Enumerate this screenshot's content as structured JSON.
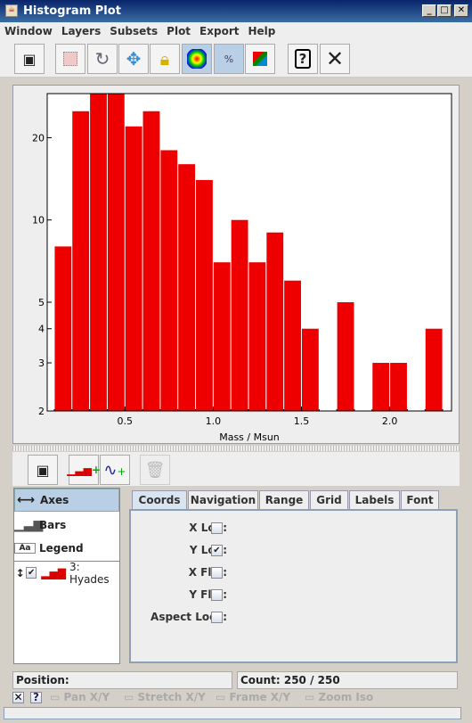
{
  "window": {
    "title": "Histogram Plot"
  },
  "menu": [
    "Window",
    "Layers",
    "Subsets",
    "Plot",
    "Export",
    "Help"
  ],
  "toolbar": [
    {
      "icon": "window-icon"
    },
    {
      "icon": "subset-draw-icon"
    },
    {
      "icon": "rescale-icon"
    },
    {
      "icon": "navigation-icon"
    },
    {
      "icon": "axis-lock-icon"
    },
    {
      "icon": "density-icon",
      "active": true
    },
    {
      "icon": "normalise-icon",
      "active": true
    },
    {
      "icon": "export-image-icon"
    },
    {
      "icon": "help-icon"
    },
    {
      "icon": "close-icon"
    }
  ],
  "chart_data": {
    "type": "bar",
    "xlabel": "Mass / Msun",
    "ylabel": "",
    "xlim": [
      0.06,
      2.35
    ],
    "ylim": [
      2,
      29
    ],
    "ylog": true,
    "bar_color": "#ee0000",
    "x_ticks": [
      "0.5",
      "1.0",
      "1.5",
      "2.0"
    ],
    "y_ticks": [
      "2",
      "3",
      "4",
      "5",
      "10",
      "20"
    ],
    "bin_width": 0.1,
    "bin_starts": [
      0.1,
      0.2,
      0.3,
      0.4,
      0.5,
      0.6,
      0.7,
      0.8,
      0.9,
      1.0,
      1.1,
      1.2,
      1.3,
      1.4,
      1.5,
      1.6,
      1.7,
      1.8,
      1.9,
      2.0,
      2.1,
      2.2
    ],
    "values": [
      8,
      25,
      29,
      29,
      22,
      25,
      18,
      16,
      14,
      7,
      10,
      7,
      9,
      6,
      4,
      1,
      5,
      1,
      3,
      3,
      1,
      4
    ]
  },
  "control": {
    "layers": [
      {
        "label": "Axes",
        "selected": true
      },
      {
        "label": "Bars"
      },
      {
        "label": "Legend"
      },
      {
        "label": "3: Hyades",
        "checked": true
      }
    ],
    "tabs": [
      "Coords",
      "Navigation",
      "Range",
      "Grid",
      "Labels",
      "Font"
    ],
    "coords": [
      {
        "label": "X Log:",
        "checked": false
      },
      {
        "label": "Y Log:",
        "checked": true
      },
      {
        "label": "X Flip:",
        "checked": false
      },
      {
        "label": "Y Flip:",
        "checked": false
      },
      {
        "label": "Aspect Lock:",
        "checked": false
      }
    ]
  },
  "status": {
    "position": "Position:",
    "count": "Count: 250 / 250"
  },
  "bottom": {
    "pan": "Pan X/Y",
    "stretch": "Stretch X/Y",
    "frame": "Frame X/Y",
    "zoom": "Zoom Iso"
  }
}
